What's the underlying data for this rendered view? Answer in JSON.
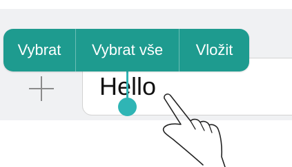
{
  "context_menu": {
    "items": [
      {
        "label": "Vybrat"
      },
      {
        "label": "Vybrat vše"
      },
      {
        "label": "Vložit"
      }
    ],
    "background_color": "#1e9b8f",
    "text_color": "#ffffff"
  },
  "input": {
    "value": "Hello",
    "cursor_color": "#2fb5b5"
  },
  "toolbar": {
    "add_icon": "plus-icon"
  },
  "gesture": {
    "icon": "hand-pointer-icon"
  }
}
